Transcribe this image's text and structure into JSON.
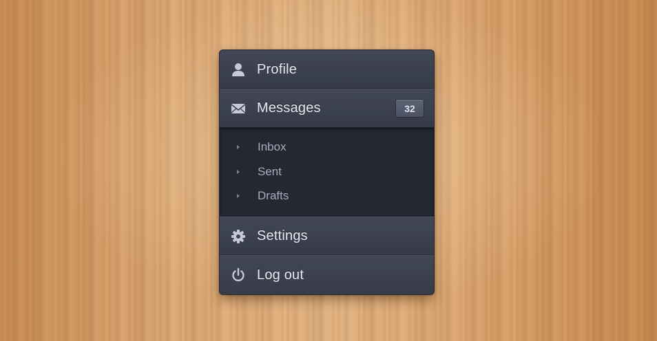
{
  "menu": {
    "items": [
      {
        "label": "Profile",
        "icon": "user-icon"
      },
      {
        "label": "Messages",
        "icon": "envelope-icon",
        "badge": "32"
      },
      {
        "label": "Settings",
        "icon": "gear-icon"
      },
      {
        "label": "Log out",
        "icon": "power-icon"
      }
    ],
    "submenu": [
      {
        "label": "Inbox"
      },
      {
        "label": "Sent"
      },
      {
        "label": "Drafts"
      }
    ]
  },
  "colors": {
    "menu_bg": "#3a3f4c",
    "submenu_bg": "#232833",
    "text": "#e8ebf2",
    "subtext": "#a6acba",
    "wood": "#d9a56e"
  }
}
